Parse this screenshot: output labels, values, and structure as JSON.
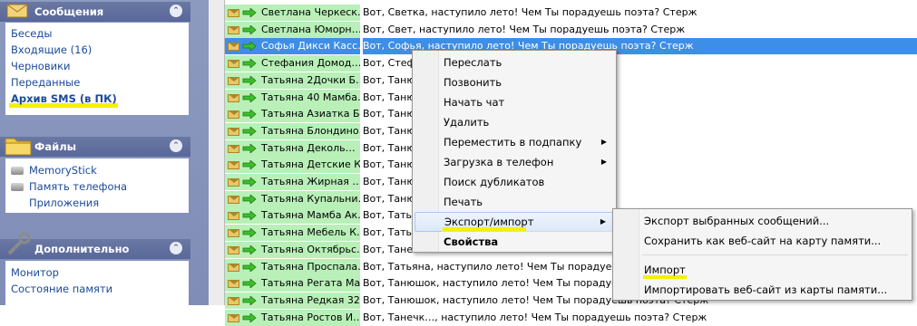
{
  "sidebar": {
    "sections": [
      {
        "title": "Сообщения",
        "icon": "envelope-icon",
        "items": [
          "Беседы",
          "Входящие (16)",
          "Черновики",
          "Переданные",
          "Архив SMS (в ПК)"
        ],
        "highlighted_index": 4
      },
      {
        "title": "Файлы",
        "icon": "folder-icon",
        "items": [
          "MemoryStick",
          "Память телефона",
          "Приложения"
        ]
      },
      {
        "title": "Дополнительно",
        "icon": "wrench-icon",
        "items": [
          "Монитор",
          "Состояние памяти"
        ]
      }
    ],
    "toggle_glyph": "⌃"
  },
  "messages": [
    {
      "name": "Светлана Черкеск…",
      "text": "Вот, Светка, наступило лето! Чем Ты порадуешь поэта? Стерж"
    },
    {
      "name": "Светлана Юморн…",
      "text": "Вот, Свет, наступило лето! Чем Ты порадуешь поэта? Стерж"
    },
    {
      "name": "Софья Дикси Касс…",
      "text": "Вот, Софья, наступило лето! Чем Ты порадуешь поэта? Стерж",
      "selected": true
    },
    {
      "name": "Стефания Домод…",
      "text": "Вот, Стефа…                                                                    а? Стерж"
    },
    {
      "name": "Татьяна 2Дочки Б…",
      "text": "Вот, Танюш…                                                                  ? Стерж"
    },
    {
      "name": "Татьяна 40 Мамба…",
      "text": "Вот, Танюш…                                                                  ? Стерж"
    },
    {
      "name": "Татьяна Азиатка Б…",
      "text": "Вот, Танюш…                                                                  а? Стерж"
    },
    {
      "name": "Татьяна Блондино…",
      "text": "Вот, Танюш…                                                                  а? Стерж"
    },
    {
      "name": "Татьяна Деколь…",
      "text": "Вот, Танюш…                                                                   ? Стерж"
    },
    {
      "name": "Татьяна Детские К…",
      "text": "Вот, Танюш…                                                                  а? Стерж"
    },
    {
      "name": "Татьяна Жирная …",
      "text": "Вот, Танюш…                                                                   ? Стерж"
    },
    {
      "name": "Татьяна Купальни…",
      "text": "Вот, Танюш…                                                                  а? Стерж"
    },
    {
      "name": "Татьяна Мамба Ак…",
      "text": "Вот, Тать…"
    },
    {
      "name": "Татьяна Мебель К…",
      "text": "Вот, Тать…"
    },
    {
      "name": "Татьяна Октябрьс…",
      "text": "Вот, Тане…"
    },
    {
      "name": "Татьяна Проспала…",
      "text": "Вот, Татьяна, наступило лето! Чем Ты порадуешь поэта? Стерж"
    },
    {
      "name": "Татьяна Регата Ма…",
      "text": "Вот, Танюшок, наступило лето! Чем Ты порадуешь поэта? Стерж"
    },
    {
      "name": "Татьяна Редкая 32…",
      "text": "Вот, Танюшок, наступило лето! Чем Ты порадуешь поэта? Стерж"
    },
    {
      "name": "Татьяна Ростов И…",
      "text": "Вот, Танечк…, наступило лето! Чем Ты порадуешь поэта? Стерж"
    }
  ],
  "context_menu": {
    "items": [
      {
        "label": "Переслать"
      },
      {
        "label": "Позвонить"
      },
      {
        "label": "Начать чат"
      },
      {
        "label": "Удалить"
      },
      {
        "label": "Переместить в подпапку",
        "submenu": true
      },
      {
        "label": "Загрузка в телефон",
        "submenu": true
      },
      {
        "label": "Поиск дубликатов"
      },
      {
        "label": "Печать"
      },
      {
        "label": "Экспорт/импорт",
        "submenu": true,
        "active": true
      },
      {
        "label": "Свойства",
        "bold": true
      }
    ],
    "submenu_arrow": "▶"
  },
  "export_submenu": {
    "items": [
      {
        "label": "Экспорт выбранных сообщений..."
      },
      {
        "label": "Сохранить как веб-сайт на карту памяти..."
      },
      {
        "label": "Импорт"
      },
      {
        "label": "Импортировать веб-сайт из карты памяти..."
      }
    ]
  },
  "colors": {
    "sidebar_bg": "#8d9abf",
    "section_header": "#5f6d9e",
    "link": "#1b4a98",
    "row_green": "#b8f0b8",
    "selection_blue": "#3d8ee6",
    "highlight_yellow": "#f4f000"
  }
}
